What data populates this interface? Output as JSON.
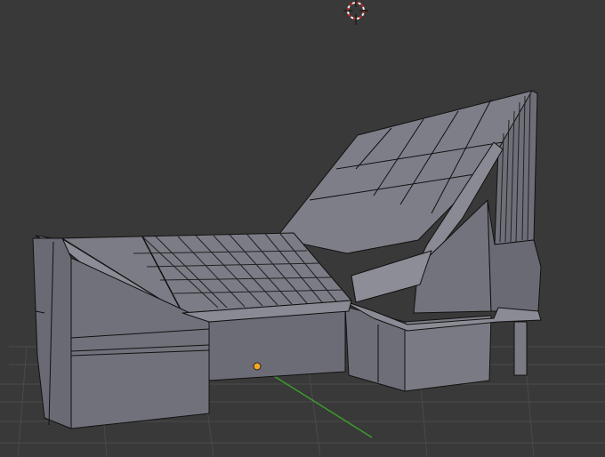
{
  "viewport": {
    "background": "#393939",
    "grid_color": "#4a4a4a",
    "y_axis_color": "#3d9c2c",
    "x_axis_color": "#8b4040"
  },
  "mesh": {
    "face_color": "#74747e",
    "face_color_light": "#83838d",
    "face_color_dark": "#63636c",
    "edge_color": "#111111"
  },
  "scene_objects": {
    "cursor_3d": {
      "icon": "3d-cursor-icon",
      "color": "#cc2222"
    },
    "origin": {
      "icon": "object-origin-dot-icon",
      "color": "#f5a623"
    },
    "model": {
      "icon": "house-mesh"
    }
  }
}
